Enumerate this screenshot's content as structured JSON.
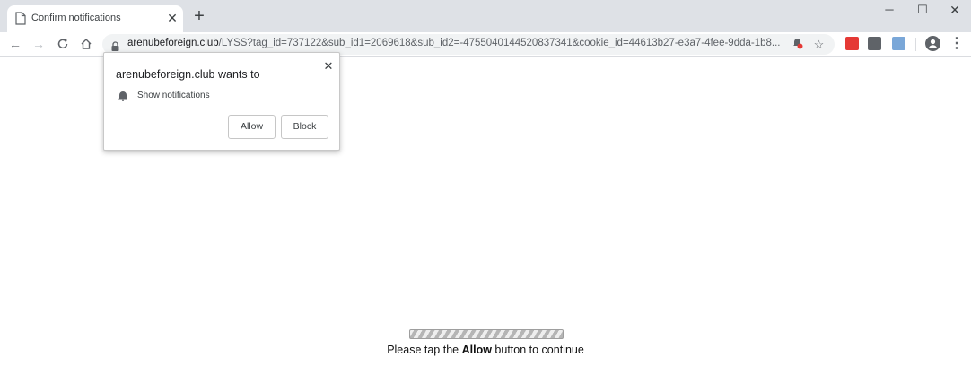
{
  "tab": {
    "title": "Confirm notifications",
    "close_glyph": "✕",
    "new_tab_glyph": "+"
  },
  "window": {
    "minimize_glyph": "─",
    "maximize_glyph": "☐",
    "close_glyph": "✕"
  },
  "toolbar": {
    "back_glyph": "←",
    "forward_glyph": "→",
    "reload_glyph": "C",
    "home_glyph": "⌂",
    "star_glyph": "☆",
    "menu_glyph": "⋮"
  },
  "omnibox": {
    "host": "arenubeforeign.club",
    "path": "/LYSS?tag_id=737122&sub_id1=2069618&sub_id2=-4755040144520837341&cookie_id=44613b27-e3a7-4fee-9dda-1b8..."
  },
  "popup": {
    "heading": "arenubeforeign.club wants to",
    "item": "Show notifications",
    "close_glyph": "✕",
    "allow_label": "Allow",
    "block_label": "Block"
  },
  "page": {
    "message_before": "Please tap the ",
    "message_bold": "Allow",
    "message_after": " button to continue"
  },
  "colors": {
    "tabstrip": "#dee1e6",
    "omnibox": "#f1f3f4",
    "ext_red": "#e53935"
  }
}
